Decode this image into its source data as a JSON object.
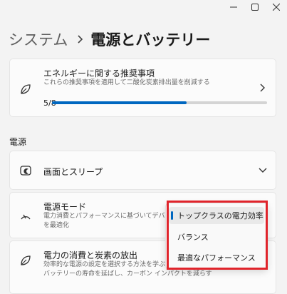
{
  "breadcrumb": {
    "root": "システム",
    "current": "電源とバッテリー"
  },
  "energy": {
    "title": "エネルギーに関する推奨事項",
    "subtitle": "これらの推奨事項を適用して二酸化炭素排出量を削減する",
    "progress_text": "5/8",
    "progress_value": 0.625
  },
  "section_heading": "電源",
  "screen_sleep": {
    "title": "画面とスリープ"
  },
  "power_mode": {
    "title": "電源モード",
    "subtitle_line1": "電力消費とパフォーマンスに基づいてデバイス",
    "subtitle_line2": "を最適化"
  },
  "power_mode_options": [
    {
      "label": "トップクラスの電力効率",
      "selected": true
    },
    {
      "label": "バランス",
      "selected": false
    },
    {
      "label": "最適なパフォーマンス",
      "selected": false
    }
  ],
  "carbon": {
    "title": "電力の消費と炭素の放出",
    "subtitle_line1": "効率的な電源の設定を選択する方法を学ぶ",
    "subtitle_line2": "バッテリーの寿命を延ばし、カーボン インパクトを減らす"
  },
  "colors": {
    "accent": "#0067c0",
    "highlight": "#e0242b"
  }
}
